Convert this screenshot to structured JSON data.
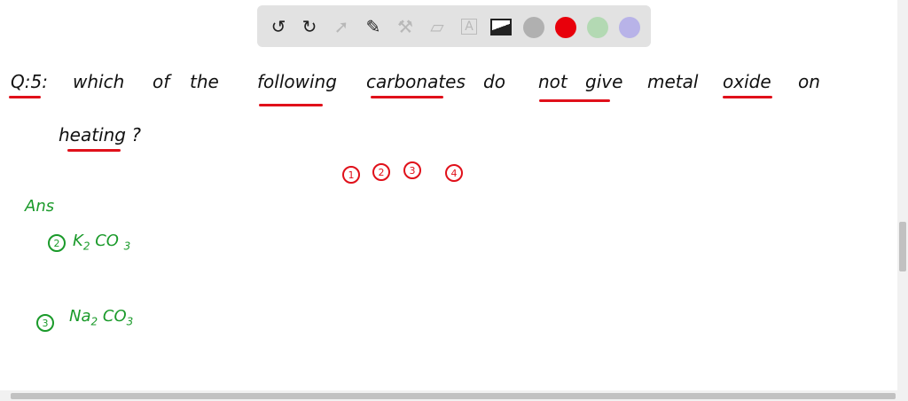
{
  "toolbar": {
    "tools": [
      "undo-icon",
      "redo-icon",
      "select-icon",
      "pen-icon",
      "tools-icon",
      "eraser-icon",
      "text-icon",
      "image-icon"
    ],
    "colors": [
      "#b0b0b0",
      "#e8000b",
      "#b3d9b3",
      "#b8b3e8"
    ]
  },
  "board": {
    "question_label": "Q:5:",
    "words": [
      "which",
      "of",
      "the",
      "following",
      "carbonates",
      "do",
      "not",
      "give",
      "metal",
      "oxide",
      "on"
    ],
    "line2": "heating ?",
    "options": [
      "1",
      "2",
      "3",
      "4"
    ],
    "answer_label": "Ans",
    "answers": [
      {
        "num": "2",
        "formula": "K",
        "sub1": "2",
        "mid": "CO",
        "sub2": "3"
      },
      {
        "num": "3",
        "formula": "Na",
        "sub1": "2",
        "mid": "CO",
        "sub2": "3"
      }
    ]
  }
}
